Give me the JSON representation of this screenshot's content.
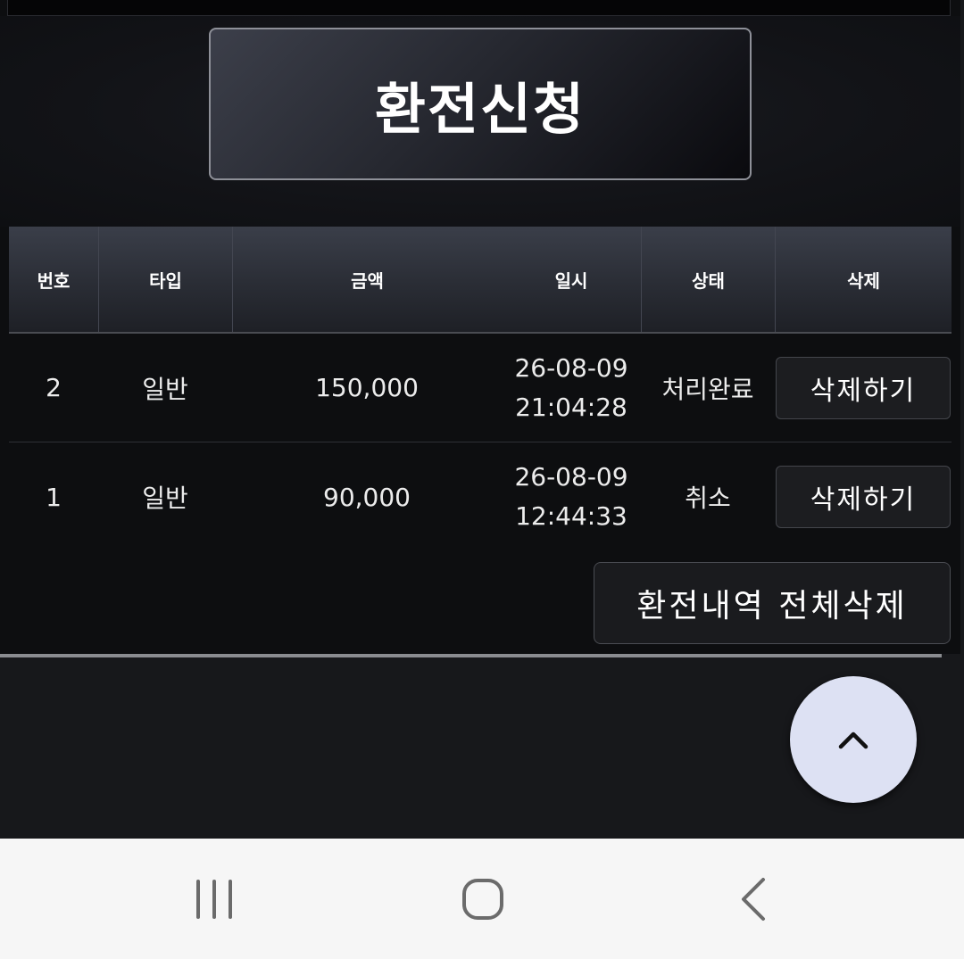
{
  "header": {
    "apply_button_label": "환전신청"
  },
  "table": {
    "columns": [
      "번호",
      "타입",
      "금액",
      "일시",
      "상태",
      "삭제"
    ],
    "rows": [
      {
        "number": "2",
        "type": "일반",
        "amount": "150,000",
        "date": "26-08-09",
        "time": "21:04:28",
        "status": "처리완료",
        "delete_label": "삭제하기"
      },
      {
        "number": "1",
        "type": "일반",
        "amount": "90,000",
        "date": "26-08-09",
        "time": "12:44:33",
        "status": "취소",
        "delete_label": "삭제하기"
      }
    ]
  },
  "actions": {
    "delete_all_label": "환전내역 전체삭제"
  },
  "icons": {
    "scroll_top": "chevron-up-icon",
    "nav_recent": "recent-apps-icon",
    "nav_home": "home-icon",
    "nav_back": "back-icon"
  },
  "colors": {
    "page_bg": "#17181b",
    "panel_bg": "#0d0e10",
    "header_gradient_light": "#3a3e49",
    "scroll_button_bg": "#dde1f3",
    "nav_bar_bg": "#f6f6f6"
  }
}
